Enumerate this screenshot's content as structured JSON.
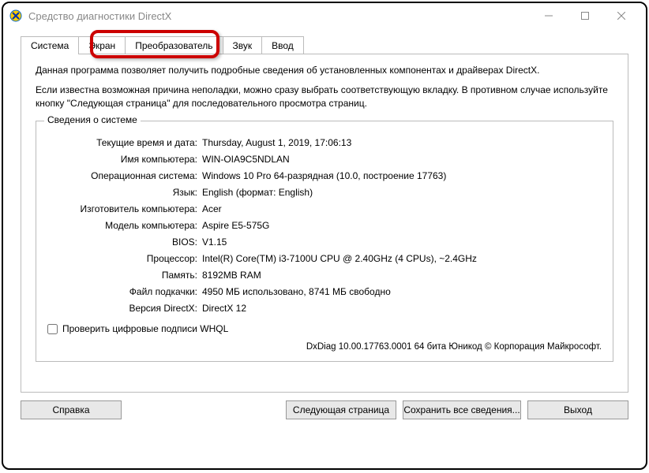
{
  "window": {
    "title": "Средство диагностики DirectX"
  },
  "tabs": {
    "system": "Система",
    "display": "Экран",
    "render": "Преобразователь",
    "sound": "Звук",
    "input": "Ввод"
  },
  "intro": {
    "p1": "Данная программа позволяет получить подробные сведения об установленных компонентах и драйверах DirectX.",
    "p2": "Если известна возможная причина неполадки, можно сразу выбрать соответствующую вкладку. В противном случае используйте кнопку \"Следующая страница\" для последовательного просмотра страниц."
  },
  "group": {
    "title": "Сведения о системе",
    "rows": {
      "datetime": {
        "label": "Текущие время и дата:",
        "value": "Thursday, August 1, 2019, 17:06:13"
      },
      "computer_name": {
        "label": "Имя компьютера:",
        "value": "WIN-OIA9C5NDLAN"
      },
      "os": {
        "label": "Операционная система:",
        "value": "Windows 10 Pro 64-разрядная (10.0, построение 17763)"
      },
      "language": {
        "label": "Язык:",
        "value": "English (формат: English)"
      },
      "manufacturer": {
        "label": "Изготовитель компьютера:",
        "value": "Acer"
      },
      "model": {
        "label": "Модель компьютера:",
        "value": "Aspire E5-575G"
      },
      "bios": {
        "label": "BIOS:",
        "value": "V1.15"
      },
      "processor": {
        "label": "Процессор:",
        "value": "Intel(R) Core(TM) i3-7100U CPU @ 2.40GHz (4 CPUs), ~2.4GHz"
      },
      "memory": {
        "label": "Память:",
        "value": "8192MB RAM"
      },
      "pagefile": {
        "label": "Файл подкачки:",
        "value": "4950 МБ использовано, 8741 МБ свободно"
      },
      "directx": {
        "label": "Версия DirectX:",
        "value": "DirectX 12"
      }
    },
    "whql_checkbox": "Проверить цифровые подписи WHQL",
    "footer": "DxDiag 10.00.17763.0001 64 бита Юникод © Корпорация Майкрософт."
  },
  "buttons": {
    "help": "Справка",
    "next": "Следующая страница",
    "save": "Сохранить все сведения...",
    "exit": "Выход"
  }
}
